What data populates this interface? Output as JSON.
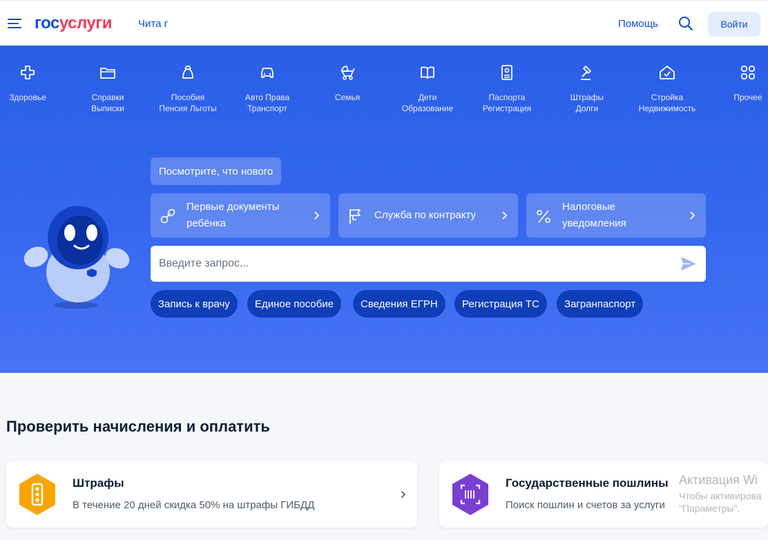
{
  "header": {
    "logo_part1": "гос",
    "logo_part2": "услуги",
    "city": "Чита г",
    "help": "Помощь",
    "login": "Войти"
  },
  "categories": [
    {
      "line1": "Здоровье",
      "line2": "",
      "icon": "health-cross-icon"
    },
    {
      "line1": "Справки",
      "line2": "Выписки",
      "icon": "folder-icon"
    },
    {
      "line1": "Пособия",
      "line2": "Пенсия Льготы",
      "icon": "wallet-bag-icon"
    },
    {
      "line1": "Авто Права",
      "line2": "Транспорт",
      "icon": "car-icon"
    },
    {
      "line1": "Семья",
      "line2": "",
      "icon": "stroller-icon"
    },
    {
      "line1": "Дети",
      "line2": "Образование",
      "icon": "book-icon"
    },
    {
      "line1": "Паспорта",
      "line2": "Регистрация",
      "icon": "passport-icon"
    },
    {
      "line1": "Штрафы",
      "line2": "Долги",
      "icon": "gavel-icon"
    },
    {
      "line1": "Стройка",
      "line2": "Недвижимость",
      "icon": "house-icon"
    },
    {
      "line1": "Прочее",
      "line2": "",
      "icon": "grid-icon"
    }
  ],
  "hero": {
    "whats_new": "Посмотрите, что нового",
    "cards": [
      {
        "line1": "Первые документы",
        "line2": "ребёнка",
        "icon": "pacifier-icon"
      },
      {
        "line1": "Служба по контракту",
        "line2": "",
        "icon": "flag-icon"
      },
      {
        "line1": "Налоговые",
        "line2": "уведомления",
        "icon": "percent-icon"
      }
    ],
    "search_placeholder": "Введите запрос...",
    "quick": [
      "Запись к врачу",
      "Единое пособие",
      "Сведения ЕГРН",
      "Регистрация ТС",
      "Загранпаспорт"
    ]
  },
  "section": {
    "title": "Проверить начисления и оплатить",
    "cards": [
      {
        "title": "Штрафы",
        "subtitle": "В течение 20 дней скидка 50% на штрафы ГИБДД",
        "icon": "traffic-light-icon",
        "color": "#f7a600"
      },
      {
        "title": "Государственные пошлины",
        "subtitle": "Поиск пошлин и счетов за услуги",
        "icon": "scan-icon",
        "color": "#7a3fd1"
      }
    ]
  },
  "watermark": {
    "line1": "Активация Wi",
    "line2": "Чтобы активирова",
    "line3": "\"Параметры\"."
  },
  "colors": {
    "brand_blue": "#0d4cd3",
    "brand_red": "#ee3f58",
    "hero_blue": "#3466ee",
    "pill_blue": "#0f3fb8"
  }
}
